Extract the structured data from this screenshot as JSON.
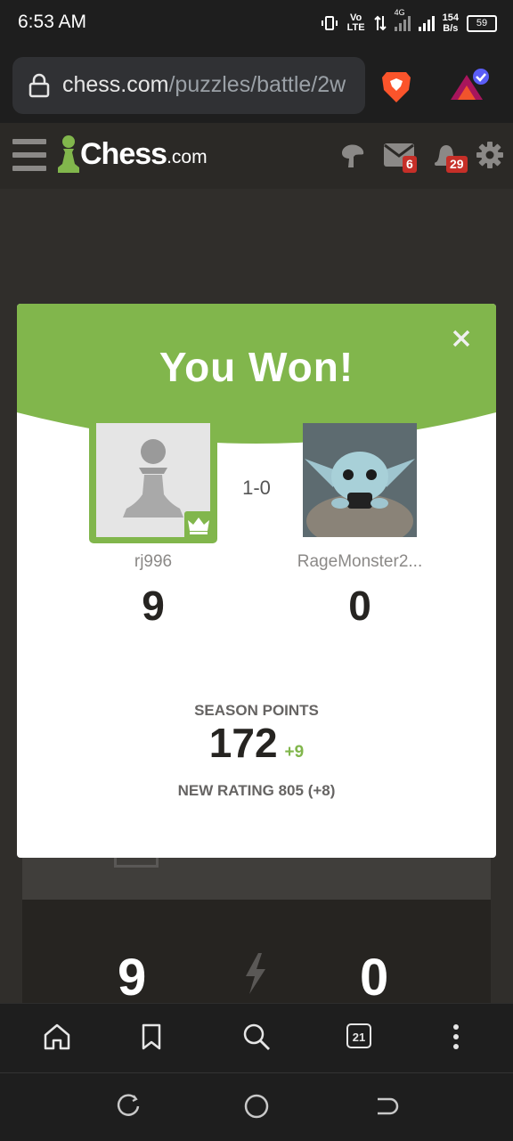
{
  "status_bar": {
    "time": "6:53 AM",
    "volte": "Vo LTE",
    "network": "4G",
    "speed": "154",
    "speed_unit": "B/s",
    "battery": "59"
  },
  "browser": {
    "url_domain": "chess.com",
    "url_path": "/puzzles/battle/2w",
    "tabs_count": "21"
  },
  "site": {
    "logo_text": "Chess",
    "logo_suffix": ".com",
    "messages_badge": "6",
    "notifications_badge": "29"
  },
  "modal": {
    "title": "You Won!",
    "result": "1-0",
    "player": {
      "name": "rj996",
      "score": "9"
    },
    "opponent": {
      "name": "RageMonster2...",
      "score": "0"
    },
    "season_label": "SEASON POINTS",
    "season_points": "172",
    "season_delta": "+9",
    "new_rating": "NEW RATING 805 (+8)"
  },
  "background_game": {
    "left_score": "9",
    "right_score": "0"
  },
  "colors": {
    "accent_green": "#81b64c",
    "badge_red": "#c62f28",
    "header_bg": "#2b2926",
    "page_bg": "#302e2b"
  }
}
